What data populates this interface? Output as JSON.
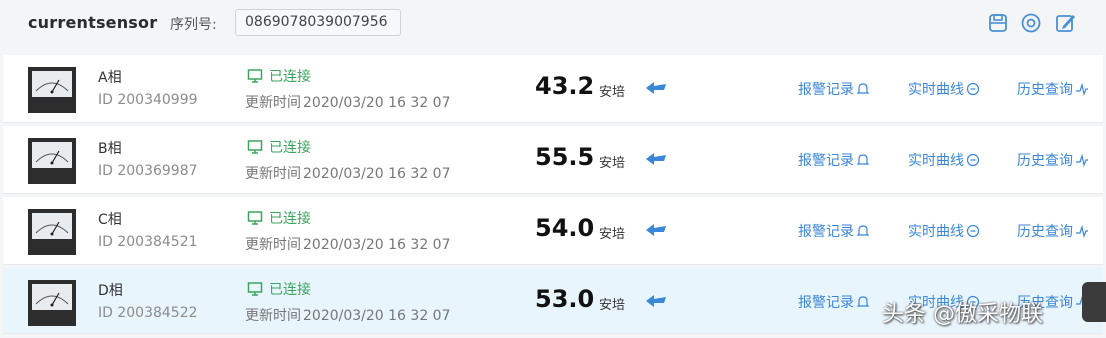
{
  "header": {
    "app_name": "currentsensor",
    "serial_label": "序列号:",
    "serial_value": "0869078039007956",
    "icons": [
      "save-icon",
      "settings-circle-icon",
      "edit-icon"
    ]
  },
  "colors": {
    "accent": "#3a86d8",
    "connected": "#3aa55e",
    "selected_row_bg": "#e9f5fd"
  },
  "rows": [
    {
      "phase": "A相",
      "id": "ID 200340999",
      "status": "已连接",
      "updated_label": "更新时间",
      "updated_time": "2020/03/20 16 32 07",
      "value": "43.2",
      "unit": "安培",
      "trend_icon": "arrow-left-icon",
      "links": {
        "alarm": "报警记录",
        "realtime": "实时曲线",
        "history": "历史查询"
      }
    },
    {
      "phase": "B相",
      "id": "ID 200369987",
      "status": "已连接",
      "updated_label": "更新时间",
      "updated_time": "2020/03/20 16 32 07",
      "value": "55.5",
      "unit": "安培",
      "trend_icon": "arrow-left-icon",
      "links": {
        "alarm": "报警记录",
        "realtime": "实时曲线",
        "history": "历史查询"
      }
    },
    {
      "phase": "C相",
      "id": "ID 200384521",
      "status": "已连接",
      "updated_label": "更新时间",
      "updated_time": "2020/03/20 16 32 07",
      "value": "54.0",
      "unit": "安培",
      "trend_icon": "arrow-left-icon",
      "links": {
        "alarm": "报警记录",
        "realtime": "实时曲线",
        "history": "历史查询"
      }
    },
    {
      "phase": "D相",
      "id": "ID 200384522",
      "status": "已连接",
      "updated_label": "更新时间",
      "updated_time": "2020/03/20 16 32 07",
      "value": "53.0",
      "unit": "安培",
      "trend_icon": "arrow-left-icon",
      "links": {
        "alarm": "报警记录",
        "realtime": "实时曲线",
        "history": "历史查询"
      }
    }
  ],
  "watermark": "头条 @傲采物联"
}
